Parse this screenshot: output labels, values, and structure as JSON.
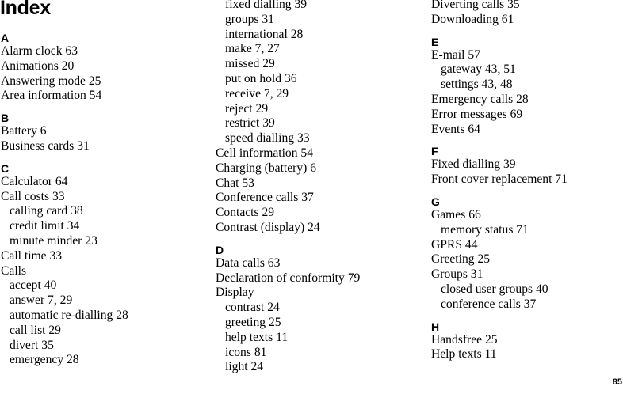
{
  "page": {
    "title": "Index",
    "page_number": "85"
  },
  "columns": [
    {
      "items": [
        {
          "type": "letter",
          "text": "A"
        },
        {
          "type": "entry",
          "text": "Alarm clock 63"
        },
        {
          "type": "entry",
          "text": "Animations 20"
        },
        {
          "type": "entry",
          "text": "Answering mode 25"
        },
        {
          "type": "entry",
          "text": "Area information 54"
        },
        {
          "type": "letter",
          "text": "B"
        },
        {
          "type": "entry",
          "text": "Battery 6"
        },
        {
          "type": "entry",
          "text": "Business cards 31"
        },
        {
          "type": "letter",
          "text": "C"
        },
        {
          "type": "entry",
          "text": "Calculator 64"
        },
        {
          "type": "entry",
          "text": "Call costs 33"
        },
        {
          "type": "sub",
          "text": "calling card 38"
        },
        {
          "type": "sub",
          "text": "credit limit 34"
        },
        {
          "type": "sub",
          "text": "minute minder 23"
        },
        {
          "type": "entry",
          "text": "Call time 33"
        },
        {
          "type": "entry",
          "text": "Calls"
        },
        {
          "type": "sub",
          "text": "accept 40"
        },
        {
          "type": "sub",
          "text": "answer 7, 29"
        },
        {
          "type": "sub",
          "text": "automatic re-dialling 28"
        },
        {
          "type": "sub",
          "text": "call list 29"
        },
        {
          "type": "sub",
          "text": "divert 35"
        },
        {
          "type": "sub",
          "text": "emergency 28"
        }
      ]
    },
    {
      "items": [
        {
          "type": "sub",
          "text": "fixed dialling 39"
        },
        {
          "type": "sub",
          "text": "groups 31"
        },
        {
          "type": "sub",
          "text": "international 28"
        },
        {
          "type": "sub",
          "text": "make 7, 27"
        },
        {
          "type": "sub",
          "text": "missed 29"
        },
        {
          "type": "sub",
          "text": "put on hold 36"
        },
        {
          "type": "sub",
          "text": "receive 7, 29"
        },
        {
          "type": "sub",
          "text": "reject 29"
        },
        {
          "type": "sub",
          "text": "restrict 39"
        },
        {
          "type": "sub",
          "text": "speed dialling 33"
        },
        {
          "type": "entry",
          "text": "Cell information 54"
        },
        {
          "type": "entry",
          "text": "Charging (battery) 6"
        },
        {
          "type": "entry",
          "text": "Chat 53"
        },
        {
          "type": "entry",
          "text": "Conference calls 37"
        },
        {
          "type": "entry",
          "text": "Contacts 29"
        },
        {
          "type": "entry",
          "text": "Contrast (display) 24"
        },
        {
          "type": "letter",
          "text": "D"
        },
        {
          "type": "entry",
          "text": "Data calls 63"
        },
        {
          "type": "entry",
          "text": "Declaration of conformity 79"
        },
        {
          "type": "entry",
          "text": "Display"
        },
        {
          "type": "sub",
          "text": "contrast 24"
        },
        {
          "type": "sub",
          "text": "greeting 25"
        },
        {
          "type": "sub",
          "text": "help texts 11"
        },
        {
          "type": "sub",
          "text": "icons 81"
        },
        {
          "type": "sub",
          "text": "light 24"
        }
      ]
    },
    {
      "items": [
        {
          "type": "entry",
          "text": "Diverting calls 35"
        },
        {
          "type": "entry",
          "text": "Downloading 61"
        },
        {
          "type": "letter",
          "text": "E"
        },
        {
          "type": "entry",
          "text": "E-mail 57"
        },
        {
          "type": "sub",
          "text": "gateway 43, 51"
        },
        {
          "type": "sub",
          "text": "settings 43, 48"
        },
        {
          "type": "entry",
          "text": "Emergency calls 28"
        },
        {
          "type": "entry",
          "text": "Error messages 69"
        },
        {
          "type": "entry",
          "text": "Events 64"
        },
        {
          "type": "letter",
          "text": "F"
        },
        {
          "type": "entry",
          "text": "Fixed dialling 39"
        },
        {
          "type": "entry",
          "text": "Front cover replacement 71"
        },
        {
          "type": "letter",
          "text": "G"
        },
        {
          "type": "entry",
          "text": "Games 66"
        },
        {
          "type": "sub",
          "text": "memory status 71"
        },
        {
          "type": "entry",
          "text": "GPRS 44"
        },
        {
          "type": "entry",
          "text": "Greeting 25"
        },
        {
          "type": "entry",
          "text": "Groups 31"
        },
        {
          "type": "sub",
          "text": "closed user groups 40"
        },
        {
          "type": "sub",
          "text": "conference calls 37"
        },
        {
          "type": "letter",
          "text": "H"
        },
        {
          "type": "entry",
          "text": "Handsfree 25"
        },
        {
          "type": "entry",
          "text": "Help texts 11"
        }
      ]
    }
  ]
}
